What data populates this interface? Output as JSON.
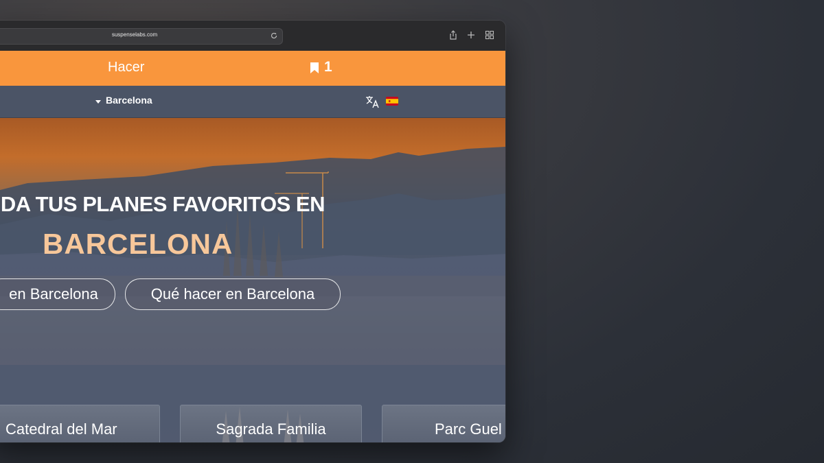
{
  "browser": {
    "url": "suspenselabs.com"
  },
  "topbar": {
    "label": "Hacer",
    "bookmark_count": "1"
  },
  "subbar": {
    "city": "Barcelona"
  },
  "hero": {
    "title": "DA TUS PLANES FAVORITOS EN",
    "city": "BARCELONA",
    "buttons": [
      "en Barcelona",
      "Qué hacer en Barcelona"
    ]
  },
  "cards": [
    "Catedral del Mar",
    "Sagrada Familia",
    "Parc Guel"
  ],
  "colors": {
    "accent": "#f9963d",
    "subbar": "#4b5466",
    "hero_city": "#f7c79a"
  },
  "icons": [
    "reload-icon",
    "share-icon",
    "plus-icon",
    "tabs-grid-icon",
    "bookmark-icon",
    "translate-icon",
    "spain-flag-icon",
    "caret-down-icon"
  ]
}
